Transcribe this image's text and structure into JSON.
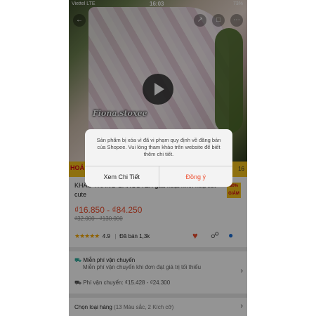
{
  "status_bar": {
    "carrier": "Viettel LTE",
    "time": "16:03",
    "battery": "73%"
  },
  "product": {
    "watermark": "Fiona.stoxee",
    "banner_tag": "HOẢ",
    "countdown": "16",
    "title": "KHẨU TRANG GARCOTEX gấu hoạt hình hoạ tiết cute",
    "badge": "30% GIẢM",
    "price": "₫16.850 - ₫84.250",
    "old_price": "₫32.000 - ₫130.000",
    "rating_value": "4.9",
    "sold": "Đã bán 1,3k"
  },
  "shipping": {
    "title": "Miễn phí vận chuyển",
    "subtitle": "Miễn phí vận chuyển khi đơn đạt giá trị tối thiểu",
    "fee_label": "Phí vận chuyển:",
    "fee_value": "₫15.428 - ₫24.300"
  },
  "variant": {
    "label": "Chọn loại hàng",
    "detail": "(13 Màu sắc, 2 Kích cỡ)"
  },
  "dialog": {
    "message": "Sản phẩm bị xóa vì đã vi phạm quy định về đăng bán của Shopee. Vui lòng tham khảo trên website để biết thêm chi tiết.",
    "left_button": "Xem Chi Tiết",
    "right_button": "Đồng ý"
  },
  "colors": {
    "accent": "#ee4d2d",
    "banner": "#f4c21a"
  }
}
